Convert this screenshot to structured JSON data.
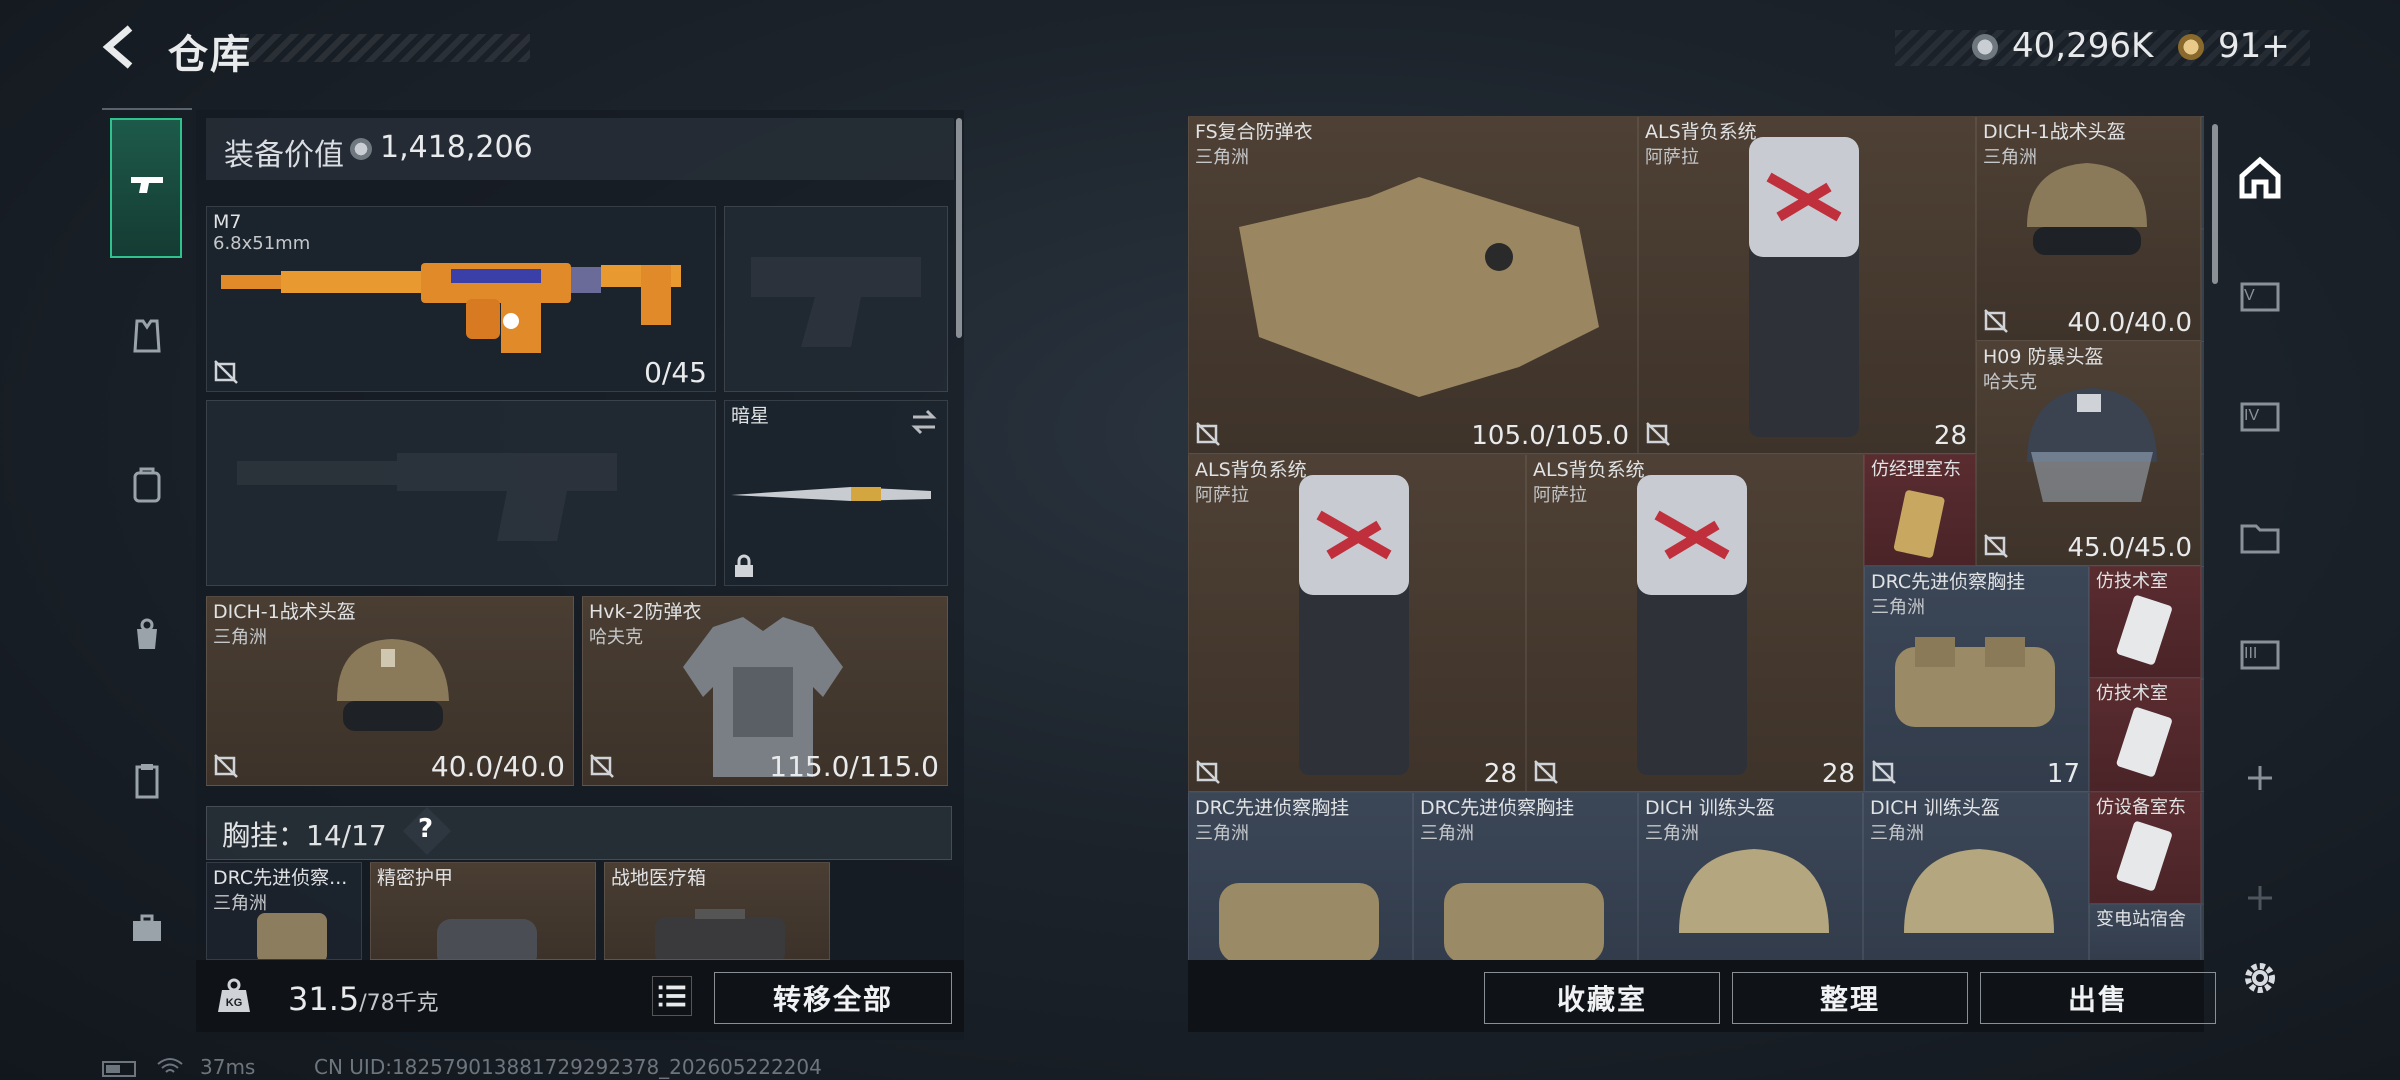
{
  "header": {
    "title": "仓库",
    "money": "40,296K",
    "points": "91+"
  },
  "equip": {
    "label": "装备价值",
    "value": "1,418,206"
  },
  "slots": {
    "primary": {
      "name": "M7",
      "caliber": "6.8x51mm",
      "ammo": "0/45"
    },
    "melee": {
      "name": "暗星"
    },
    "helmet": {
      "name": "DICH-1战术头盔",
      "maker": "三角洲",
      "durability": "40.0/40.0"
    },
    "armor": {
      "name": "Hvk-2防弹衣",
      "maker": "哈夫克",
      "durability": "115.0/115.0"
    }
  },
  "rig": {
    "label": "胸挂：14/17",
    "help": "?"
  },
  "rig_items": [
    {
      "name": "DRC先进侦察...",
      "maker": "三角洲"
    },
    {
      "name": "精密护甲",
      "maker": ""
    },
    {
      "name": "战地医疗箱",
      "maker": ""
    }
  ],
  "weight": {
    "current": "31.5",
    "cap": "/78千克"
  },
  "buttons": {
    "transfer_all": "转移全部",
    "collection": "收藏室",
    "organize": "整理",
    "sell": "出售"
  },
  "status": {
    "ping": "37ms",
    "uid": "CN UID:1825790138817292923​78_202605222204"
  },
  "grid_items": [
    {
      "name": "FS复合防弹衣",
      "maker": "三角洲",
      "value": "105.0/105.0"
    },
    {
      "name": "ALS背负系统",
      "maker": "阿萨拉",
      "value": "28"
    },
    {
      "name": "DICH-1战术头盔",
      "maker": "三角洲",
      "value": "40.0/40.0"
    },
    {
      "name": "H09 防暴头盔",
      "maker": "哈夫克",
      "value": "45.0/45.0"
    },
    {
      "name": "ALS背负系统",
      "maker": "阿萨拉",
      "value": "28"
    },
    {
      "name": "ALS背负系统",
      "maker": "阿萨拉",
      "value": "28"
    },
    {
      "name": "仿经理室东",
      "maker": "",
      "value": ""
    },
    {
      "name": "DRC先进侦察胸挂",
      "maker": "三角洲",
      "value": "17"
    },
    {
      "name": "仿技术室",
      "maker": "",
      "value": ""
    },
    {
      "name": "仿技术室",
      "maker": "",
      "value": ""
    },
    {
      "name": "DRC先进侦察胸挂",
      "maker": "三角洲",
      "value": ""
    },
    {
      "name": "DRC先进侦察胸挂",
      "maker": "三角洲",
      "value": ""
    },
    {
      "name": "DICH 训练头盔",
      "maker": "三角洲",
      "value": ""
    },
    {
      "name": "DICH 训练头盔",
      "maker": "三角洲",
      "value": ""
    },
    {
      "name": "仿设备室东",
      "maker": "",
      "value": ""
    },
    {
      "name": "变电站宿舍",
      "maker": "",
      "value": ""
    }
  ],
  "colors": {
    "accent": "#2fc28c",
    "item_brown": "#4e4034",
    "item_red": "#5a2c30",
    "item_slate": "#3b4657"
  }
}
